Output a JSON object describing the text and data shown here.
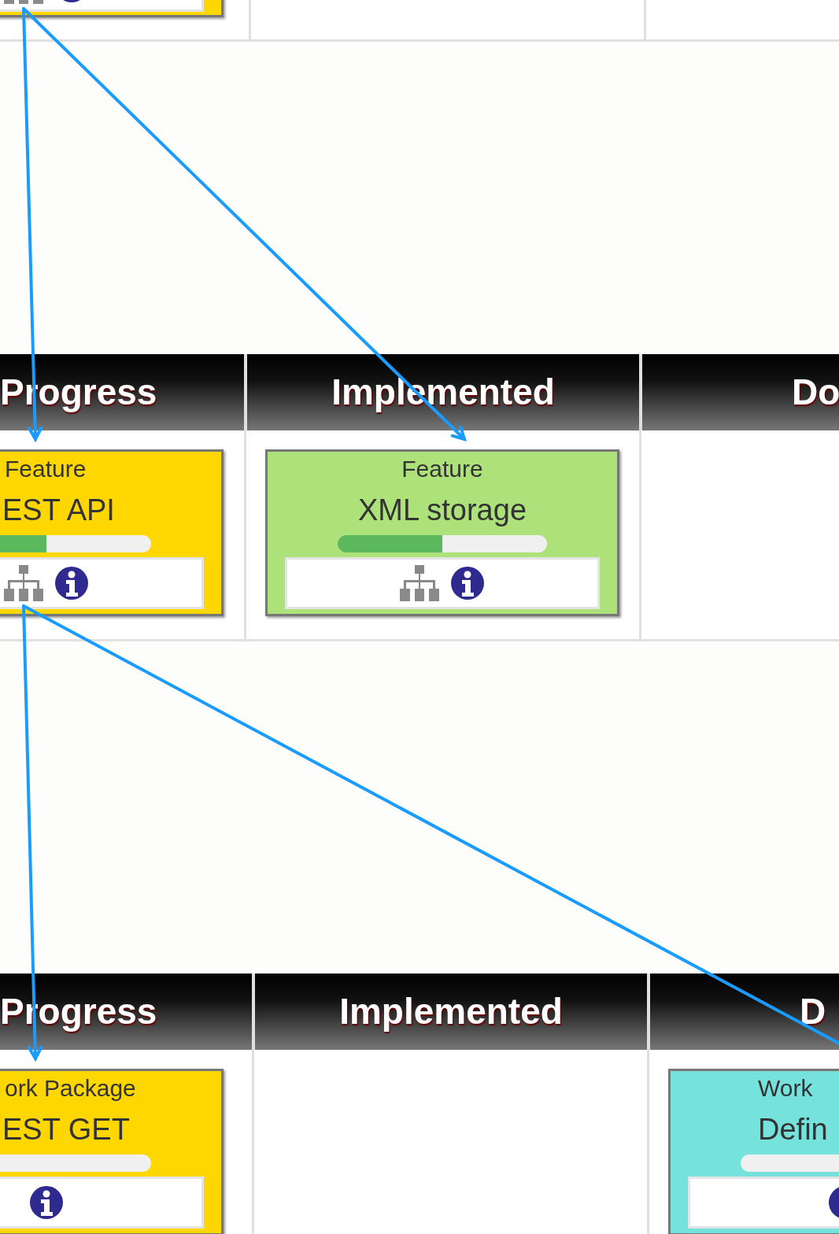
{
  "boards": [
    {
      "columns": [
        {
          "cards": [
            {
              "color": "#ffd700",
              "has_children": true
            }
          ]
        },
        {},
        {}
      ]
    },
    {
      "columns": [
        {
          "header": "Progress",
          "cards": [
            {
              "type": "Feature",
              "title": "EST API",
              "color": "#ffd700",
              "level": 0.5,
              "has_children": true
            }
          ]
        },
        {
          "header": "Implemented",
          "cards": [
            {
              "type": "Feature",
              "title": "XML storage",
              "color": "#ade27a",
              "level": 0.5,
              "has_children": true
            }
          ]
        },
        {
          "header": "Do"
        }
      ]
    },
    {
      "columns": [
        {
          "header": "Progress",
          "cards": [
            {
              "type": "ork Package",
              "title": "EST GET",
              "color": "#ffd700",
              "level": 0,
              "has_children": false
            }
          ]
        },
        {
          "header": "Implemented"
        },
        {
          "header": "D",
          "cards": [
            {
              "type": "Work",
              "title": "Defin",
              "color": "#76e2dc",
              "level": 0,
              "has_children": false
            }
          ]
        }
      ]
    }
  ]
}
